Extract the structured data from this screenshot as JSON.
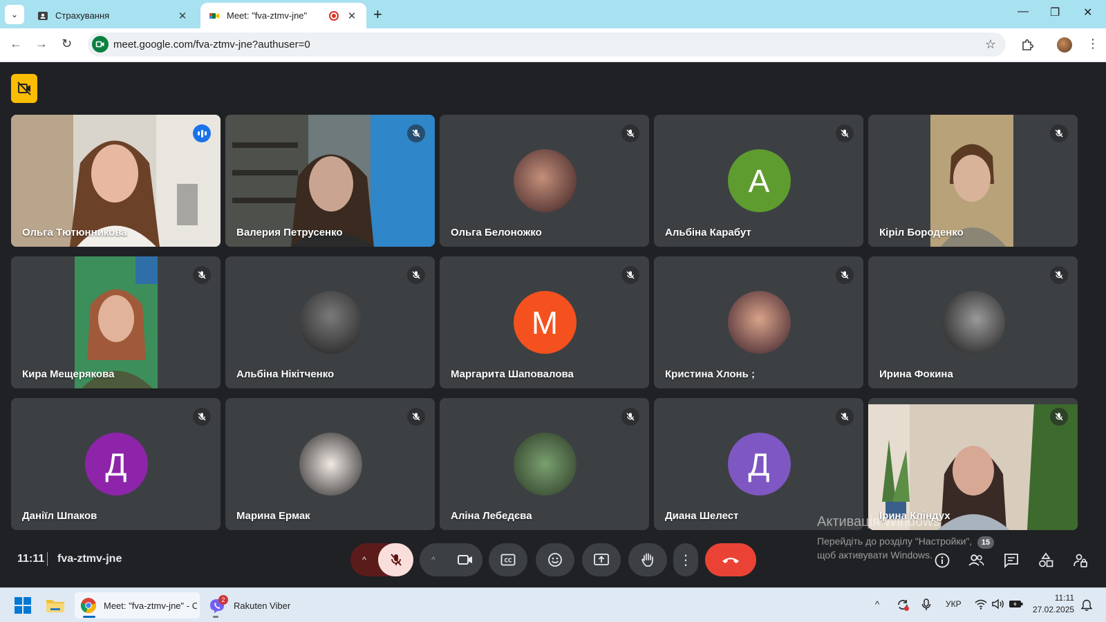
{
  "browser": {
    "tabs": [
      {
        "title": "Страхування",
        "active": false
      },
      {
        "title": "Meet: \"fva-ztmv-jne\"",
        "active": true
      }
    ],
    "url": "meet.google.com/fva-ztmv-jne?authuser=0",
    "icons": {
      "tab_list": "chevron-down-icon",
      "new_tab": "plus-icon",
      "back": "arrow-left-icon",
      "forward": "arrow-right-icon",
      "reload": "reload-icon",
      "bookmark": "star-icon",
      "extensions": "puzzle-icon",
      "menu": "three-dots-vertical-icon"
    },
    "glyphs": {
      "tab_list": "⌄",
      "close": "✕",
      "new_tab": "+",
      "back": "←",
      "forward": "→",
      "reload": "↻",
      "star": "☆",
      "more": "⋮",
      "minimize": "—",
      "restore": "❐",
      "window_close": "✕"
    }
  },
  "meeting": {
    "time": "11:11",
    "code": "fva-ztmv-jne",
    "participant_count": "15",
    "participants": [
      {
        "name": "Ольга Тютюнникова",
        "type": "video",
        "speaking": true,
        "muted": false
      },
      {
        "name": "Валерия Петрусенко",
        "type": "video",
        "muted": true
      },
      {
        "name": "Ольга Белоножко",
        "type": "photo",
        "muted": true
      },
      {
        "name": "Альбіна Карабут",
        "type": "letter",
        "letter": "А",
        "color": "#5f9c2f",
        "muted": true
      },
      {
        "name": "Кіріл Бороденко",
        "type": "video",
        "muted": true
      },
      {
        "name": "Кира Мещерякова",
        "type": "video",
        "muted": true
      },
      {
        "name": "Альбіна Нікітченко",
        "type": "photo",
        "muted": true
      },
      {
        "name": "Маргарита Шаповалова",
        "type": "letter",
        "letter": "М",
        "color": "#f4511e",
        "muted": true
      },
      {
        "name": "Кристина Хлонь ;",
        "type": "photo",
        "muted": true
      },
      {
        "name": "Ирина Фокина",
        "type": "photo",
        "muted": true
      },
      {
        "name": "Даніїл Шпаков",
        "type": "letter",
        "letter": "Д",
        "color": "#8e24aa",
        "muted": true
      },
      {
        "name": "Марина Ермак",
        "type": "photo",
        "muted": true
      },
      {
        "name": "Аліна Лебедєва",
        "type": "photo",
        "muted": true
      },
      {
        "name": "Диана Шелест",
        "type": "letter",
        "letter": "Д",
        "color": "#7e57c2",
        "muted": true
      },
      {
        "name": "Ірина Кліндух",
        "type": "video",
        "muted": true
      }
    ],
    "controls": {
      "more_glyph": "⋮",
      "mic_options_glyph": "^",
      "cam_options_glyph": "^"
    }
  },
  "watermark": {
    "title": "Активація Windows",
    "text": "Перейдіть до розділу \"Настройки\", щоб активувати Windows."
  },
  "taskbar": {
    "chrome_label": "Meet: \"fva-ztmv-jne\" - C",
    "viber_label": "Rakuten Viber",
    "viber_badge": "2",
    "language": "УКР",
    "time": "11:11",
    "date": "27.02.2025",
    "tray_up_glyph": "^"
  },
  "colors": {
    "meet_bg": "#202124",
    "tile_bg": "#3c4043",
    "active_outline": "#8ab4f8",
    "hangup": "#ea4335",
    "mic_off_bg": "#f9dedc",
    "recording_badge": "#fbbc04",
    "tabstrip": "#a8e1f0"
  }
}
